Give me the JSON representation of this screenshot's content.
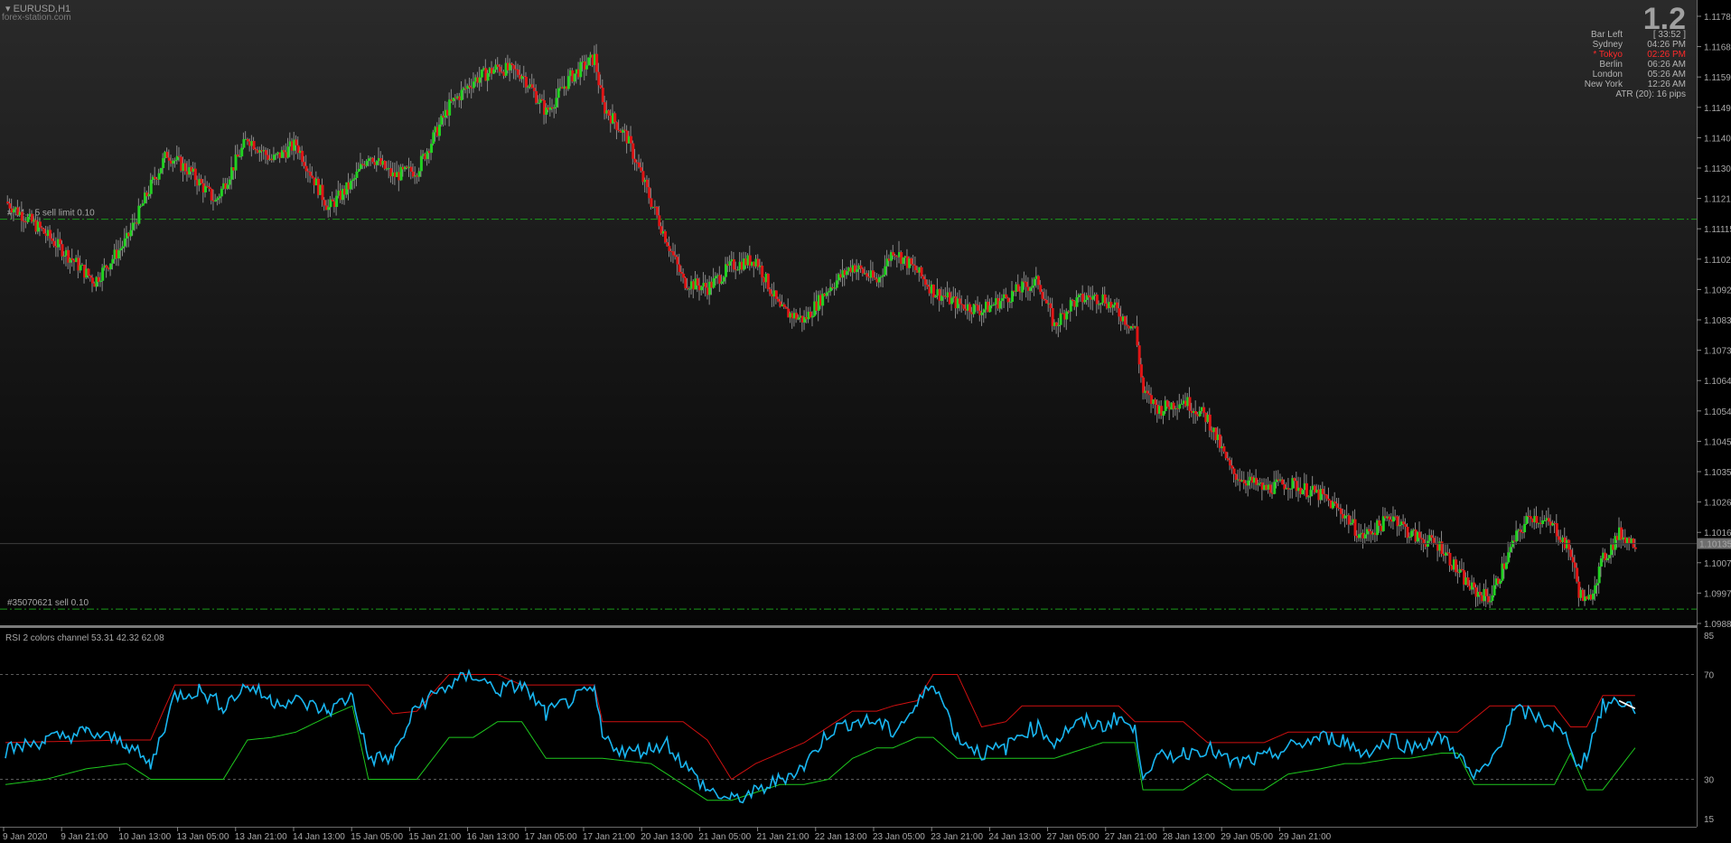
{
  "header": {
    "symbol": "EURUSD,H1",
    "site": "forex-station.com"
  },
  "info_panel": {
    "big_value": "1.2",
    "rows": [
      {
        "label": "Bar Left",
        "value": "[ 33:52 ]",
        "color": "#b4b4b4"
      },
      {
        "label": "Sydney",
        "value": "04:26 PM",
        "color": "#b4b4b4"
      },
      {
        "label": "* Tokyo",
        "value": "02:26 PM",
        "color": "#ff2a2a"
      },
      {
        "label": "Berlin",
        "value": "06:26 AM",
        "color": "#b4b4b4"
      },
      {
        "label": "London",
        "value": "05:26 AM",
        "color": "#b4b4b4"
      },
      {
        "label": "New York",
        "value": "12:26 AM",
        "color": "#b4b4b4"
      }
    ],
    "atr": "ATR (20): 16 pips"
  },
  "orders": [
    {
      "label": "#...4....5 sell limit 0.10",
      "price": 1.11145
    },
    {
      "label": "#35070621 sell 0.10",
      "price": 1.09925
    }
  ],
  "current_price_label": "1.10135",
  "rsi_label": "RSI 2 colors channel 53.31 42.32 62.08",
  "colors": {
    "bull": "#22d122",
    "bear": "#e01515",
    "rsi": "#19b6f0",
    "upper": "#d01010",
    "lower": "#1ec81e",
    "grid": "#5a5a5a",
    "order_line": "#1a9a1a"
  },
  "chart_data": [
    {
      "type": "candlestick",
      "symbol": "EURUSD",
      "timeframe": "H1",
      "ylim": [
        1.0988,
        1.1178
      ],
      "y_ticks": [
        "1.11780",
        "1.11685",
        "1.11590",
        "1.11495",
        "1.11400",
        "1.11305",
        "1.11210",
        "1.11115",
        "1.11020",
        "1.10925",
        "1.10830",
        "1.10735",
        "1.10640",
        "1.10545",
        "1.10450",
        "1.10355",
        "1.10260",
        "1.10165",
        "1.10070",
        "1.09975",
        "1.09880"
      ],
      "x_ticks": [
        "9 Jan 2020",
        "9 Jan 21:00",
        "10 Jan 13:00",
        "13 Jan 05:00",
        "13 Jan 21:00",
        "14 Jan 13:00",
        "15 Jan 05:00",
        "15 Jan 21:00",
        "16 Jan 13:00",
        "17 Jan 05:00",
        "17 Jan 21:00",
        "20 Jan 13:00",
        "21 Jan 05:00",
        "21 Jan 21:00",
        "22 Jan 13:00",
        "23 Jan 05:00",
        "23 Jan 21:00",
        "24 Jan 13:00",
        "27 Jan 05:00",
        "27 Jan 21:00",
        "28 Jan 13:00",
        "29 Jan 05:00",
        "29 Jan 21:00"
      ],
      "close_path": [
        [
          0,
          1.112
        ],
        [
          4,
          1.1112
        ],
        [
          7,
          1.1105
        ],
        [
          11,
          1.1095
        ],
        [
          15,
          1.1108
        ],
        [
          18,
          1.1125
        ],
        [
          20,
          1.1135
        ],
        [
          23,
          1.1129
        ],
        [
          26,
          1.112
        ],
        [
          30,
          1.114
        ],
        [
          33,
          1.1133
        ],
        [
          36,
          1.1138
        ],
        [
          40,
          1.1118
        ],
        [
          43,
          1.1126
        ],
        [
          45,
          1.1135
        ],
        [
          48,
          1.1128
        ],
        [
          51,
          1.113
        ],
        [
          55,
          1.115
        ],
        [
          58,
          1.1158
        ],
        [
          61,
          1.1162
        ],
        [
          64,
          1.116
        ],
        [
          67,
          1.1148
        ],
        [
          70,
          1.1159
        ],
        [
          73,
          1.1165
        ],
        [
          74,
          1.115
        ],
        [
          77,
          1.114
        ],
        [
          80,
          1.112
        ],
        [
          84,
          1.1095
        ],
        [
          87,
          1.1093
        ],
        [
          90,
          1.11
        ],
        [
          93,
          1.1102
        ],
        [
          96,
          1.1086
        ],
        [
          99,
          1.1083
        ],
        [
          102,
          1.1093
        ],
        [
          105,
          1.11
        ],
        [
          108,
          1.1095
        ],
        [
          110,
          1.1105
        ],
        [
          113,
          1.1098
        ],
        [
          115,
          1.1092
        ],
        [
          118,
          1.1088
        ],
        [
          121,
          1.1086
        ],
        [
          124,
          1.109
        ],
        [
          126,
          1.1093
        ],
        [
          128,
          1.1095
        ],
        [
          130,
          1.1081
        ],
        [
          132,
          1.1088
        ],
        [
          134,
          1.109
        ],
        [
          136,
          1.109
        ],
        [
          138,
          1.1085
        ],
        [
          140,
          1.108
        ],
        [
          141,
          1.106
        ],
        [
          143,
          1.1055
        ],
        [
          146,
          1.1058
        ],
        [
          149,
          1.1052
        ],
        [
          152,
          1.1035
        ],
        [
          156,
          1.103
        ],
        [
          159,
          1.1032
        ],
        [
          163,
          1.1028
        ],
        [
          166,
          1.1022
        ],
        [
          168,
          1.1015
        ],
        [
          170,
          1.1018
        ],
        [
          172,
          1.1022
        ],
        [
          174,
          1.1016
        ],
        [
          178,
          1.1012
        ],
        [
          180,
          1.1004
        ],
        [
          182,
          1.0998
        ],
        [
          184,
          1.0996
        ],
        [
          187,
          1.1014
        ],
        [
          189,
          1.1022
        ],
        [
          192,
          1.1018
        ],
        [
          194,
          1.101
        ],
        [
          195,
          1.0998
        ],
        [
          196,
          1.0994
        ],
        [
          198,
          1.1008
        ],
        [
          200,
          1.1016
        ],
        [
          202,
          1.1013
        ]
      ],
      "extra_points": {
        "price_labels_note": "values read approximately from axis"
      }
    },
    {
      "type": "line",
      "name_label": "RSI 2 colors channel",
      "ylim": [
        15,
        85
      ],
      "y_ticks": [
        "85",
        "70",
        "30",
        "15"
      ],
      "levels": [
        70,
        30
      ],
      "values_last": {
        "rsi": 53.31,
        "lower": 42.32,
        "upper": 62.08
      },
      "rsi_path": [
        [
          0,
          41
        ],
        [
          5,
          45
        ],
        [
          10,
          48
        ],
        [
          15,
          44
        ],
        [
          18,
          35
        ],
        [
          21,
          62
        ],
        [
          24,
          64
        ],
        [
          27,
          58
        ],
        [
          30,
          66
        ],
        [
          33,
          60
        ],
        [
          36,
          60
        ],
        [
          40,
          56
        ],
        [
          43,
          62
        ],
        [
          45,
          38
        ],
        [
          48,
          38
        ],
        [
          51,
          58
        ],
        [
          55,
          66
        ],
        [
          58,
          70
        ],
        [
          61,
          64
        ],
        [
          64,
          66
        ],
        [
          67,
          55
        ],
        [
          70,
          60
        ],
        [
          73,
          64
        ],
        [
          74,
          46
        ],
        [
          77,
          40
        ],
        [
          80,
          42
        ],
        [
          82,
          44
        ],
        [
          84,
          36
        ],
        [
          87,
          26
        ],
        [
          90,
          22
        ],
        [
          93,
          25
        ],
        [
          96,
          30
        ],
        [
          99,
          35
        ],
        [
          102,
          48
        ],
        [
          105,
          52
        ],
        [
          108,
          52
        ],
        [
          110,
          48
        ],
        [
          113,
          58
        ],
        [
          115,
          68
        ],
        [
          118,
          46
        ],
        [
          121,
          40
        ],
        [
          124,
          42
        ],
        [
          126,
          48
        ],
        [
          128,
          50
        ],
        [
          130,
          44
        ],
        [
          132,
          50
        ],
        [
          134,
          52
        ],
        [
          136,
          50
        ],
        [
          138,
          54
        ],
        [
          140,
          48
        ],
        [
          141,
          33
        ],
        [
          143,
          38
        ],
        [
          146,
          40
        ],
        [
          149,
          42
        ],
        [
          152,
          36
        ],
        [
          156,
          38
        ],
        [
          159,
          42
        ],
        [
          163,
          46
        ],
        [
          166,
          45
        ],
        [
          168,
          40
        ],
        [
          170,
          42
        ],
        [
          172,
          46
        ],
        [
          174,
          42
        ],
        [
          178,
          46
        ],
        [
          180,
          40
        ],
        [
          182,
          30
        ],
        [
          184,
          36
        ],
        [
          187,
          56
        ],
        [
          189,
          55
        ],
        [
          192,
          50
        ],
        [
          194,
          44
        ],
        [
          195,
          34
        ],
        [
          196,
          40
        ],
        [
          198,
          58
        ],
        [
          200,
          60
        ],
        [
          202,
          57
        ]
      ],
      "upper_path": [
        [
          0,
          44
        ],
        [
          15,
          45
        ],
        [
          18,
          45
        ],
        [
          21,
          66
        ],
        [
          30,
          66
        ],
        [
          36,
          66
        ],
        [
          43,
          66
        ],
        [
          45,
          66
        ],
        [
          48,
          55
        ],
        [
          51,
          56
        ],
        [
          55,
          70
        ],
        [
          61,
          70
        ],
        [
          64,
          66
        ],
        [
          67,
          66
        ],
        [
          70,
          66
        ],
        [
          73,
          66
        ],
        [
          74,
          52
        ],
        [
          80,
          52
        ],
        [
          84,
          52
        ],
        [
          87,
          45
        ],
        [
          90,
          30
        ],
        [
          93,
          36
        ],
        [
          96,
          40
        ],
        [
          99,
          44
        ],
        [
          102,
          50
        ],
        [
          105,
          56
        ],
        [
          108,
          56
        ],
        [
          110,
          58
        ],
        [
          113,
          60
        ],
        [
          115,
          70
        ],
        [
          118,
          70
        ],
        [
          121,
          50
        ],
        [
          124,
          52
        ],
        [
          126,
          58
        ],
        [
          130,
          58
        ],
        [
          134,
          58
        ],
        [
          138,
          58
        ],
        [
          140,
          52
        ],
        [
          141,
          52
        ],
        [
          146,
          52
        ],
        [
          149,
          44
        ],
        [
          152,
          44
        ],
        [
          156,
          44
        ],
        [
          159,
          48
        ],
        [
          163,
          48
        ],
        [
          166,
          48
        ],
        [
          168,
          48
        ],
        [
          172,
          48
        ],
        [
          174,
          48
        ],
        [
          178,
          48
        ],
        [
          180,
          48
        ],
        [
          184,
          58
        ],
        [
          187,
          58
        ],
        [
          192,
          58
        ],
        [
          194,
          50
        ],
        [
          196,
          50
        ],
        [
          198,
          62
        ],
        [
          202,
          62
        ]
      ],
      "lower_path": [
        [
          0,
          28
        ],
        [
          5,
          30
        ],
        [
          10,
          34
        ],
        [
          15,
          36
        ],
        [
          18,
          30
        ],
        [
          21,
          30
        ],
        [
          27,
          30
        ],
        [
          30,
          45
        ],
        [
          33,
          46
        ],
        [
          36,
          48
        ],
        [
          40,
          54
        ],
        [
          43,
          58
        ],
        [
          45,
          30
        ],
        [
          48,
          30
        ],
        [
          51,
          30
        ],
        [
          55,
          46
        ],
        [
          58,
          46
        ],
        [
          61,
          52
        ],
        [
          64,
          52
        ],
        [
          67,
          38
        ],
        [
          70,
          38
        ],
        [
          73,
          38
        ],
        [
          74,
          38
        ],
        [
          80,
          36
        ],
        [
          84,
          28
        ],
        [
          87,
          22
        ],
        [
          90,
          22
        ],
        [
          93,
          25
        ],
        [
          96,
          28
        ],
        [
          99,
          28
        ],
        [
          102,
          30
        ],
        [
          105,
          38
        ],
        [
          108,
          42
        ],
        [
          110,
          42
        ],
        [
          113,
          46
        ],
        [
          115,
          46
        ],
        [
          118,
          38
        ],
        [
          121,
          38
        ],
        [
          124,
          38
        ],
        [
          126,
          38
        ],
        [
          128,
          38
        ],
        [
          130,
          38
        ],
        [
          134,
          42
        ],
        [
          136,
          44
        ],
        [
          138,
          44
        ],
        [
          140,
          44
        ],
        [
          141,
          26
        ],
        [
          143,
          26
        ],
        [
          146,
          26
        ],
        [
          149,
          32
        ],
        [
          152,
          26
        ],
        [
          156,
          26
        ],
        [
          159,
          32
        ],
        [
          163,
          34
        ],
        [
          166,
          36
        ],
        [
          168,
          36
        ],
        [
          172,
          38
        ],
        [
          174,
          38
        ],
        [
          178,
          40
        ],
        [
          180,
          40
        ],
        [
          182,
          28
        ],
        [
          184,
          28
        ],
        [
          187,
          28
        ],
        [
          192,
          28
        ],
        [
          194,
          40
        ],
        [
          196,
          26
        ],
        [
          198,
          26
        ],
        [
          202,
          42
        ]
      ]
    }
  ]
}
